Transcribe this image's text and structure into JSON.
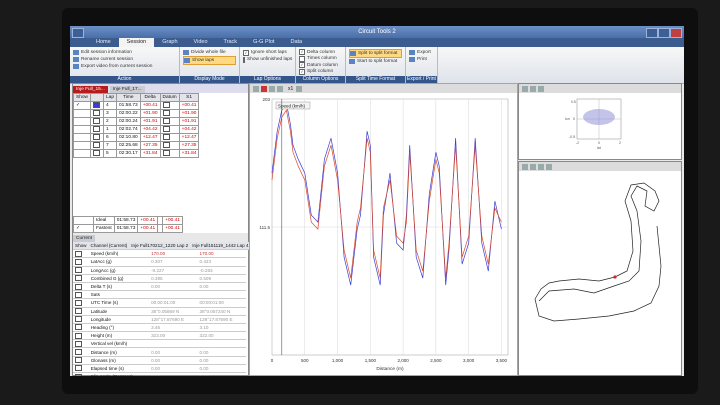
{
  "app": {
    "title": "Circuit Tools 2"
  },
  "menu": [
    "Home",
    "Session",
    "Graph",
    "Video",
    "Track",
    "G-G Plot",
    "Data"
  ],
  "ribbon": {
    "action": {
      "label": "Action",
      "items": [
        "Edit session information",
        "Rename current session",
        "Export video from current session"
      ]
    },
    "display": {
      "label": "Display Mode",
      "items": [
        "Divide whole file",
        "Show laps"
      ]
    },
    "lap": {
      "label": "Lap Options",
      "items": [
        "Ignore short laps",
        "Show unfinished laps"
      ]
    },
    "column": {
      "label": "Column Options",
      "items": [
        "Delta column",
        "Times column",
        "Datum column",
        "Split column"
      ]
    },
    "split": {
      "label": "Split Time Format",
      "items": [
        "Split to split format",
        "Start to split format"
      ]
    },
    "export": {
      "label": "Export / Print",
      "items": [
        "Export",
        "Print"
      ]
    }
  },
  "session_tabs": [
    "Inje Full_15...",
    "Inje Full_17..."
  ],
  "laps_table": {
    "headers": [
      "Show",
      "",
      "Lap",
      "Time",
      "Delta",
      "Datum",
      "S1"
    ],
    "rows": [
      {
        "lap": "4",
        "time": "01:58.73",
        "delta": "+00.41",
        "s1": "+00.41",
        "checked": "✓"
      },
      {
        "lap": "3",
        "time": "02:00.22",
        "delta": "+01.90",
        "s1": "+01.90",
        "checked": ""
      },
      {
        "lap": "2",
        "time": "02:00.24",
        "delta": "+01.91",
        "s1": "+01.91",
        "checked": ""
      },
      {
        "lap": "1",
        "time": "02:02.74",
        "delta": "+04.42",
        "s1": "+04.42",
        "checked": ""
      },
      {
        "lap": "6",
        "time": "02:10.80",
        "delta": "+12.47",
        "s1": "+12.47",
        "checked": ""
      },
      {
        "lap": "7",
        "time": "02:25.68",
        "delta": "+27.35",
        "s1": "+27.35",
        "checked": ""
      },
      {
        "lap": "5",
        "time": "02:30.17",
        "delta": "+31.84",
        "s1": "+31.84",
        "checked": ""
      }
    ],
    "footer": [
      {
        "label": "Ideal",
        "time": "01:58.73",
        "delta": "+00.41",
        "s1": "+00.41"
      },
      {
        "label": "Fastest",
        "time": "01:58.73",
        "delta": "+00.41",
        "s1": "+00.41"
      }
    ]
  },
  "channels": {
    "tab": "Current",
    "headers": {
      "show": "Show",
      "channel": "Channel (Current)",
      "c1": "Inje Full170212_1220 Lap 2",
      "c2": "Inje Full151119_1442 Lap 4"
    },
    "rows": [
      {
        "name": "Speed (km/h)",
        "v1": "170.00",
        "v2": "170.00"
      },
      {
        "name": "LatAcc (g)",
        "v1": "0.307",
        "v2": "0.423"
      },
      {
        "name": "LongAcc (g)",
        "v1": "-0.227",
        "v2": "-0.283"
      },
      {
        "name": "Combined G (g)",
        "v1": "0.395",
        "v2": "0.509"
      },
      {
        "name": "Delta T (s)",
        "v1": "0.00",
        "v2": "0.00"
      },
      {
        "name": "Sats",
        "v1": "",
        "v2": ""
      },
      {
        "name": "UTC Time (s)",
        "v1": "00:00:01:00",
        "v2": "00:00:01:00"
      },
      {
        "name": "Latitude",
        "v1": "38°0.05869 N",
        "v2": "38°0.057240 N"
      },
      {
        "name": "Longitude",
        "v1": "128°17.87690 E",
        "v2": "128°17.87690 E"
      },
      {
        "name": "Heading (°)",
        "v1": "3.46",
        "v2": "3.10"
      },
      {
        "name": "Height (m)",
        "v1": "323.00",
        "v2": "322.00"
      },
      {
        "name": "Vertical vel (km/h)",
        "v1": "",
        "v2": ""
      },
      {
        "name": "Distance (m)",
        "v1": "0.00",
        "v2": "0.00"
      },
      {
        "name": "Glonass (m)",
        "v1": "0.00",
        "v2": "0.00"
      },
      {
        "name": "Elapsed time (s)",
        "v1": "0.00",
        "v2": "0.00"
      },
      {
        "name": "Slip Angle (Degrees)",
        "v1": "0.00",
        "v2": "0.00"
      },
      {
        "name": "RPM",
        "v1": "0.00",
        "v2": "0.00"
      }
    ]
  },
  "graph": {
    "zoom": "x1",
    "legend": "Speed (km/h)"
  },
  "colors": {
    "blue_series": "#3b3bd6",
    "red_series": "#d84a2a",
    "accent": "#e39a3a"
  },
  "chart_data": {
    "type": "line",
    "title": "",
    "xlabel": "Distance (m)",
    "ylabel": "",
    "xlim": [
      0,
      3600
    ],
    "ylim": [
      20,
      203
    ],
    "y_tick_labels": [
      "203",
      "111.5"
    ],
    "x_ticks": [
      0,
      500,
      1000,
      1500,
      2000,
      2500,
      3000,
      3500
    ],
    "x_tick_labels": [
      "0",
      "500",
      "1,000",
      "1,500",
      "2,000",
      "2,500",
      "3,000",
      "3,500"
    ],
    "grid": true,
    "legend": "top-left",
    "series": [
      {
        "name": "",
        "x": [
          0,
          80,
          150,
          220,
          280,
          320,
          400,
          500,
          600,
          700,
          800,
          900,
          1000,
          1100,
          1200,
          1300,
          1350,
          1450,
          1500,
          1550,
          1650,
          1700,
          1800,
          1900,
          2000,
          2050,
          2100,
          2200,
          2300,
          2400,
          2500,
          2550,
          2650,
          2700,
          2800,
          2900,
          3000,
          3100,
          3200,
          3300,
          3400,
          3500
        ],
        "y": [
          150,
          180,
          195,
          200,
          185,
          170,
          160,
          150,
          120,
          115,
          160,
          175,
          150,
          90,
          70,
          110,
          120,
          180,
          170,
          90,
          70,
          120,
          150,
          100,
          95,
          120,
          170,
          90,
          75,
          135,
          165,
          155,
          70,
          95,
          175,
          85,
          100,
          175,
          100,
          80,
          130,
          110
        ]
      },
      {
        "name": "",
        "x": [
          0,
          80,
          150,
          220,
          280,
          320,
          400,
          500,
          600,
          700,
          800,
          900,
          1000,
          1100,
          1200,
          1300,
          1350,
          1450,
          1500,
          1550,
          1650,
          1700,
          1800,
          1900,
          2000,
          2050,
          2100,
          2200,
          2300,
          2400,
          2500,
          2550,
          2650,
          2700,
          2800,
          2900,
          3000,
          3100,
          3200,
          3300,
          3400,
          3500
        ],
        "y": [
          145,
          175,
          190,
          195,
          180,
          165,
          155,
          145,
          115,
          110,
          155,
          170,
          145,
          95,
          75,
          115,
          125,
          175,
          165,
          95,
          75,
          125,
          145,
          105,
          100,
          115,
          165,
          95,
          80,
          130,
          160,
          150,
          75,
          100,
          170,
          90,
          105,
          170,
          105,
          85,
          125,
          115
        ]
      }
    ]
  },
  "gg_plot": {
    "y_ticks": [
      "0.5",
      "0",
      "-0.5"
    ],
    "x_ticks": [
      "-2",
      "0",
      "2"
    ],
    "x_label": "lat",
    "y_label": "lon"
  }
}
